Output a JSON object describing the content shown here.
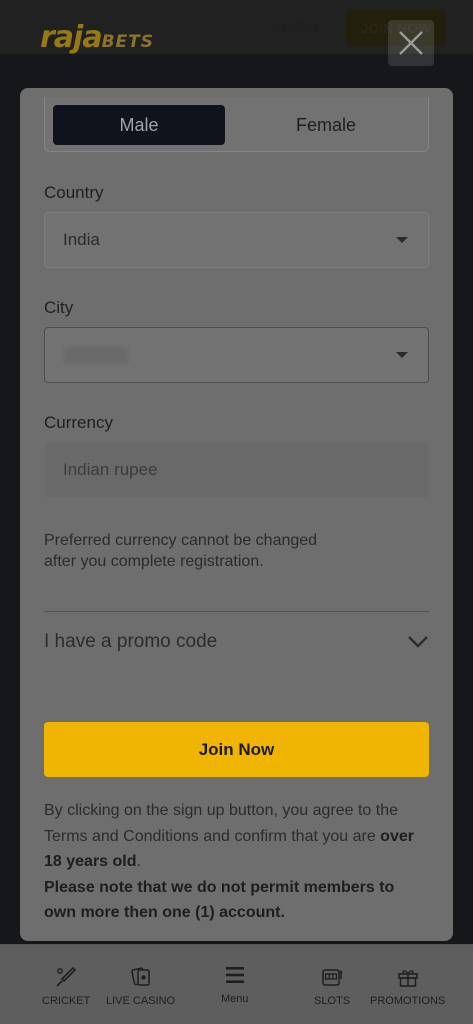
{
  "header": {
    "logo_main": "raja",
    "logo_sub": "BETS",
    "login_label": "LOGIN",
    "join_label": "JOIN NOW"
  },
  "form": {
    "gender": {
      "options": [
        "Male",
        "Female"
      ],
      "selected": "Male"
    },
    "country": {
      "label": "Country",
      "value": "India"
    },
    "city": {
      "label": "City",
      "value": ""
    },
    "currency": {
      "label": "Currency",
      "value": "Indian rupee"
    },
    "currency_note_line1": "Preferred currency cannot be changed",
    "currency_note_line2": "after you complete registration.",
    "promo_label": "I have a promo code",
    "submit_label": "Join Now",
    "terms": {
      "part1": "By clicking on the sign up button, you agree to the Terms and Conditions and confirm that you are ",
      "bold_age": "over 18 years old",
      "part2": ".",
      "notice": "Please note that we do not permit members to own more then one (1) account."
    }
  },
  "bottom_nav": [
    {
      "label": "CRICKET",
      "icon": "cricket-bat-icon"
    },
    {
      "label": "LIVE CASINO",
      "icon": "playing-cards-icon"
    },
    {
      "label": "Menu",
      "icon": "hamburger-menu-icon"
    },
    {
      "label": "SLOTS",
      "icon": "slot-machine-icon"
    },
    {
      "label": "PROMOTIONS",
      "icon": "gift-icon"
    }
  ],
  "colors": {
    "accent": "#f0b402",
    "selected_gender_bg": "#10131c"
  }
}
